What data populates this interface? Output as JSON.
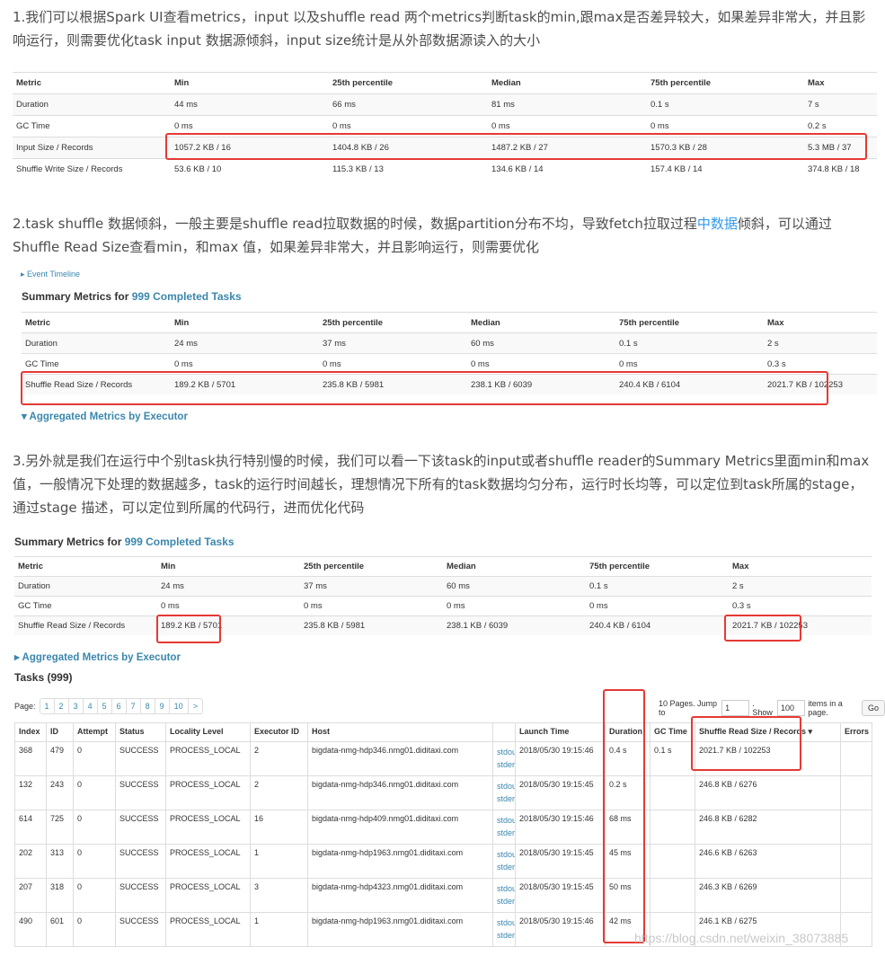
{
  "p1": "1.我们可以根据Spark UI查看metrics，input 以及shuffle read 两个metrics判断task的min,跟max是否差异较大，如果差异非常大，并且影响运行，则需要优化task input 数据源倾斜，input size统计是从外部数据源读入的大小",
  "p2_pre": "2.task shuffle 数据倾斜，一般主要是shuffle read拉取数据的时候，数据partition分布不均，导致fetch拉取过程",
  "p2_link": "中数据",
  "p2_post": "倾斜，可以通过Shuffle Read Size查看min，和max 值，如果差异非常大，并且影响运行，则需要优化",
  "p3": "3.另外就是我们在运行中个别task执行特别慢的时候，我们可以看一下该task的input或者shuffle reader的Summary Metrics里面min和max值，一般情况下处理的数据越多，task的运行时间越长，理想情况下所有的task数据均匀分布，运行时长均等，可以定位到task所属的stage，通过stage 描述，可以定位到所属的代码行，进而优化代码",
  "t1": {
    "headers": [
      "Metric",
      "Min",
      "25th percentile",
      "Median",
      "75th percentile",
      "Max"
    ],
    "rows": [
      [
        "Duration",
        "44 ms",
        "66 ms",
        "81 ms",
        "0.1 s",
        "7 s"
      ],
      [
        "GC Time",
        "0 ms",
        "0 ms",
        "0 ms",
        "0 ms",
        "0.2 s"
      ],
      [
        "Input Size / Records",
        "1057.2 KB / 16",
        "1404.8 KB / 26",
        "1487.2 KB / 27",
        "1570.3 KB / 28",
        "5.3 MB / 37"
      ],
      [
        "Shuffle Write Size / Records",
        "53.6 KB / 10",
        "115.3 KB / 13",
        "134.6 KB / 14",
        "157.4 KB / 14",
        "374.8 KB / 18"
      ]
    ]
  },
  "event_timeline": "▸ Event Timeline",
  "summary_title_pre": "Summary Metrics for ",
  "summary_title_link": "999 Completed Tasks",
  "t2": {
    "headers": [
      "Metric",
      "Min",
      "25th percentile",
      "Median",
      "75th percentile",
      "Max"
    ],
    "rows": [
      [
        "Duration",
        "24 ms",
        "37 ms",
        "60 ms",
        "0.1 s",
        "2 s"
      ],
      [
        "GC Time",
        "0 ms",
        "0 ms",
        "0 ms",
        "0 ms",
        "0.3 s"
      ],
      [
        "Shuffle Read Size / Records",
        "189.2 KB / 5701",
        "235.8 KB / 5981",
        "238.1 KB / 6039",
        "240.4 KB / 6104",
        "2021.7 KB / 102253"
      ]
    ]
  },
  "agg_metrics_open": "▾ Aggregated Metrics by Executor",
  "agg_metrics_closed": "▸ Aggregated Metrics by Executor",
  "tasks_title": "Tasks (999)",
  "pager": {
    "label": "Page:",
    "pages": [
      "1",
      "2",
      "3",
      "4",
      "5",
      "6",
      "7",
      "8",
      "9",
      "10",
      ">"
    ],
    "pages_count": "10 Pages. Jump to",
    "jump_value": "1",
    "show_label": ". Show",
    "show_value": "100",
    "items_label": "items in a page.",
    "go": "Go"
  },
  "tasks": {
    "headers": [
      "Index",
      "ID",
      "Attempt",
      "Status",
      "Locality Level",
      "Executor ID",
      "Host",
      "",
      "Launch Time",
      "Duration",
      "GC Time",
      "Shuffle Read Size / Records ▾",
      "Errors"
    ],
    "rows": [
      [
        "368",
        "479",
        "0",
        "SUCCESS",
        "PROCESS_LOCAL",
        "2",
        "bigdata-nmg-hdp346.nmg01.diditaxi.com",
        "2018/05/30 19:15:46",
        "0.4 s",
        "0.1 s",
        "2021.7 KB / 102253"
      ],
      [
        "132",
        "243",
        "0",
        "SUCCESS",
        "PROCESS_LOCAL",
        "2",
        "bigdata-nmg-hdp346.nmg01.diditaxi.com",
        "2018/05/30 19:15:45",
        "0.2 s",
        "",
        "246.8 KB / 6276"
      ],
      [
        "614",
        "725",
        "0",
        "SUCCESS",
        "PROCESS_LOCAL",
        "16",
        "bigdata-nmg-hdp409.nmg01.diditaxi.com",
        "2018/05/30 19:15:46",
        "68 ms",
        "",
        "246.8 KB / 6282"
      ],
      [
        "202",
        "313",
        "0",
        "SUCCESS",
        "PROCESS_LOCAL",
        "1",
        "bigdata-nmg-hdp1963.nmg01.diditaxi.com",
        "2018/05/30 19:15:45",
        "45 ms",
        "",
        "246.6 KB / 6263"
      ],
      [
        "207",
        "318",
        "0",
        "SUCCESS",
        "PROCESS_LOCAL",
        "3",
        "bigdata-nmg-hdp4323.nmg01.diditaxi.com",
        "2018/05/30 19:15:45",
        "50 ms",
        "",
        "246.3 KB / 6269"
      ],
      [
        "490",
        "601",
        "0",
        "SUCCESS",
        "PROCESS_LOCAL",
        "1",
        "bigdata-nmg-hdp1963.nmg01.diditaxi.com",
        "2018/05/30 19:15:46",
        "42 ms",
        "",
        "246.1 KB / 6275"
      ]
    ],
    "stdout": "stdout",
    "stderr": "stderr"
  },
  "watermark": "https://blog.csdn.net/weixin_38073885",
  "colors": {
    "highlight_box": "#e53935",
    "link_blue": "#3a87ad",
    "csdn_link": "#3399ea"
  }
}
